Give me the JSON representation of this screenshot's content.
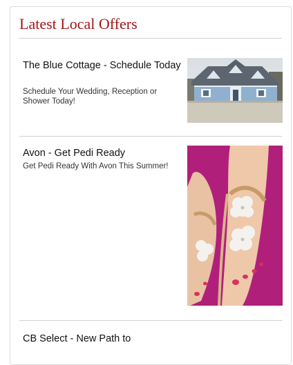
{
  "widget": {
    "title": "Latest Local Offers"
  },
  "offers": [
    {
      "title": "The Blue Cottage - Schedule Today",
      "description": "Schedule Your Wedding, Reception or Shower Today!",
      "image": "house-photo"
    },
    {
      "title": "Avon - Get Pedi Ready",
      "description": "Get Pedi Ready With Avon This Summer!",
      "image": "feet-sandals-photo"
    },
    {
      "title": "CB Select - New Path to",
      "description": ""
    }
  ],
  "colors": {
    "title": "#a31515",
    "rule": "#d0d0d0",
    "magenta_bg": "#b0207a"
  }
}
